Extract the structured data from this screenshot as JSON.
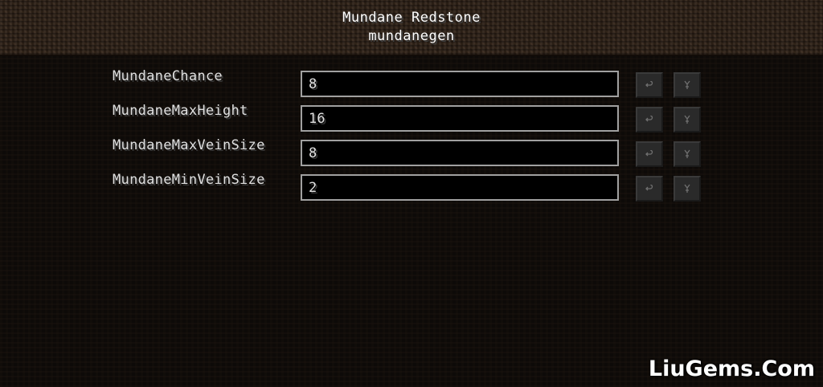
{
  "header": {
    "title": "Mundane Redstone",
    "subtitle": "mundanegen"
  },
  "config_entries": [
    {
      "label": "MundaneChance",
      "value": "8"
    },
    {
      "label": "MundaneMaxHeight",
      "value": "16"
    },
    {
      "label": "MundaneMaxVeinSize",
      "value": "8"
    },
    {
      "label": "MundaneMinVeinSize",
      "value": "2"
    }
  ],
  "icons": {
    "undo": "undo-arrow-icon",
    "reset_default": "reset-default-icon"
  },
  "colors": {
    "header_bg": "#2f2218",
    "list_bg": "#0d0a08",
    "label_text": "#e0e0e0",
    "input_border": "#a0a0a0",
    "button_bg": "#2a2a2a"
  },
  "watermark": "LiuGems.Com"
}
